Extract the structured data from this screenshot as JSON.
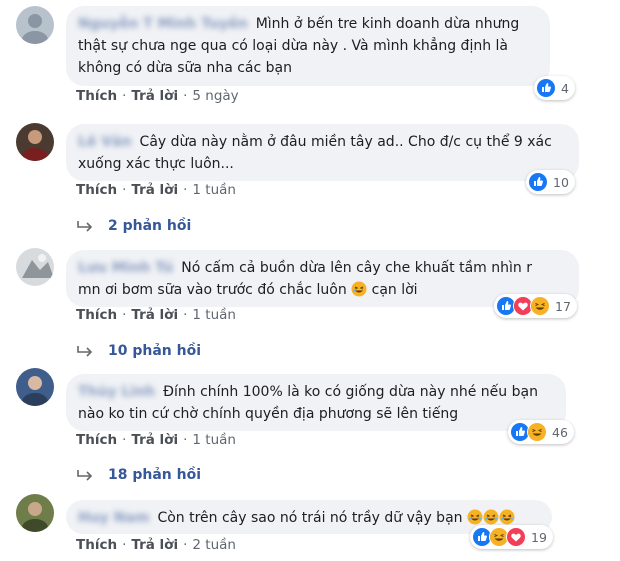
{
  "actions": {
    "like": "Thích",
    "reply": "Trả lời",
    "sep": "·"
  },
  "reply_icon": "reply-arrow-icon",
  "colors": {
    "like": "#1877f2",
    "love": "#f33e58",
    "haha": "#f7b125",
    "link": "#365899",
    "bubble": "#f0f2f5"
  },
  "comments": [
    {
      "author": "Nguyễn T Minh Tuyền",
      "text_lines": [
        "Mình ở bến tre kinh doanh dừa nhưng",
        "thật sự chưa nge qua có loại dừa này . Và mình khẳng định là",
        "không có dừa sữa nha các bạn"
      ],
      "time": "5 ngày",
      "reactions": [
        "like"
      ],
      "reaction_count": "4"
    },
    {
      "author": "Lê Văn",
      "text_lines": [
        "Cây dừa này nằm ở đâu miền tây ad.. Cho đ/c cụ thể 9 xác",
        "xuống xác thực luôn..."
      ],
      "time": "1 tuần",
      "reactions": [
        "like"
      ],
      "reaction_count": "10",
      "replies": "2 phản hồi"
    },
    {
      "author": "Lưu Minh Tú",
      "text_lines": [
        "Nó cấm cả buồn dừa lên cây che khuất tầm nhìn r",
        "mn ơi bơm sữa vào trước đó chắc luôn",
        "cạn lời"
      ],
      "time": "1 tuần",
      "reactions": [
        "like",
        "love",
        "haha"
      ],
      "reaction_count": "17",
      "replies": "10 phản hồi"
    },
    {
      "author": "Thùy Linh",
      "text_lines": [
        "Đính chính 100% là ko có giống dừa này nhé nếu bạn",
        "nào ko tin cứ chờ chính quyền địa phương sẽ lên tiếng"
      ],
      "time": "1 tuần",
      "reactions": [
        "like",
        "haha"
      ],
      "reaction_count": "46",
      "replies": "18 phản hồi"
    },
    {
      "author": "Huy Nam",
      "text_lines": [
        "Còn trên cây sao nó trái nó trầy dữ vậy bạn"
      ],
      "time": "2 tuần",
      "reactions": [
        "like",
        "haha",
        "love"
      ],
      "reaction_count": "19"
    }
  ]
}
